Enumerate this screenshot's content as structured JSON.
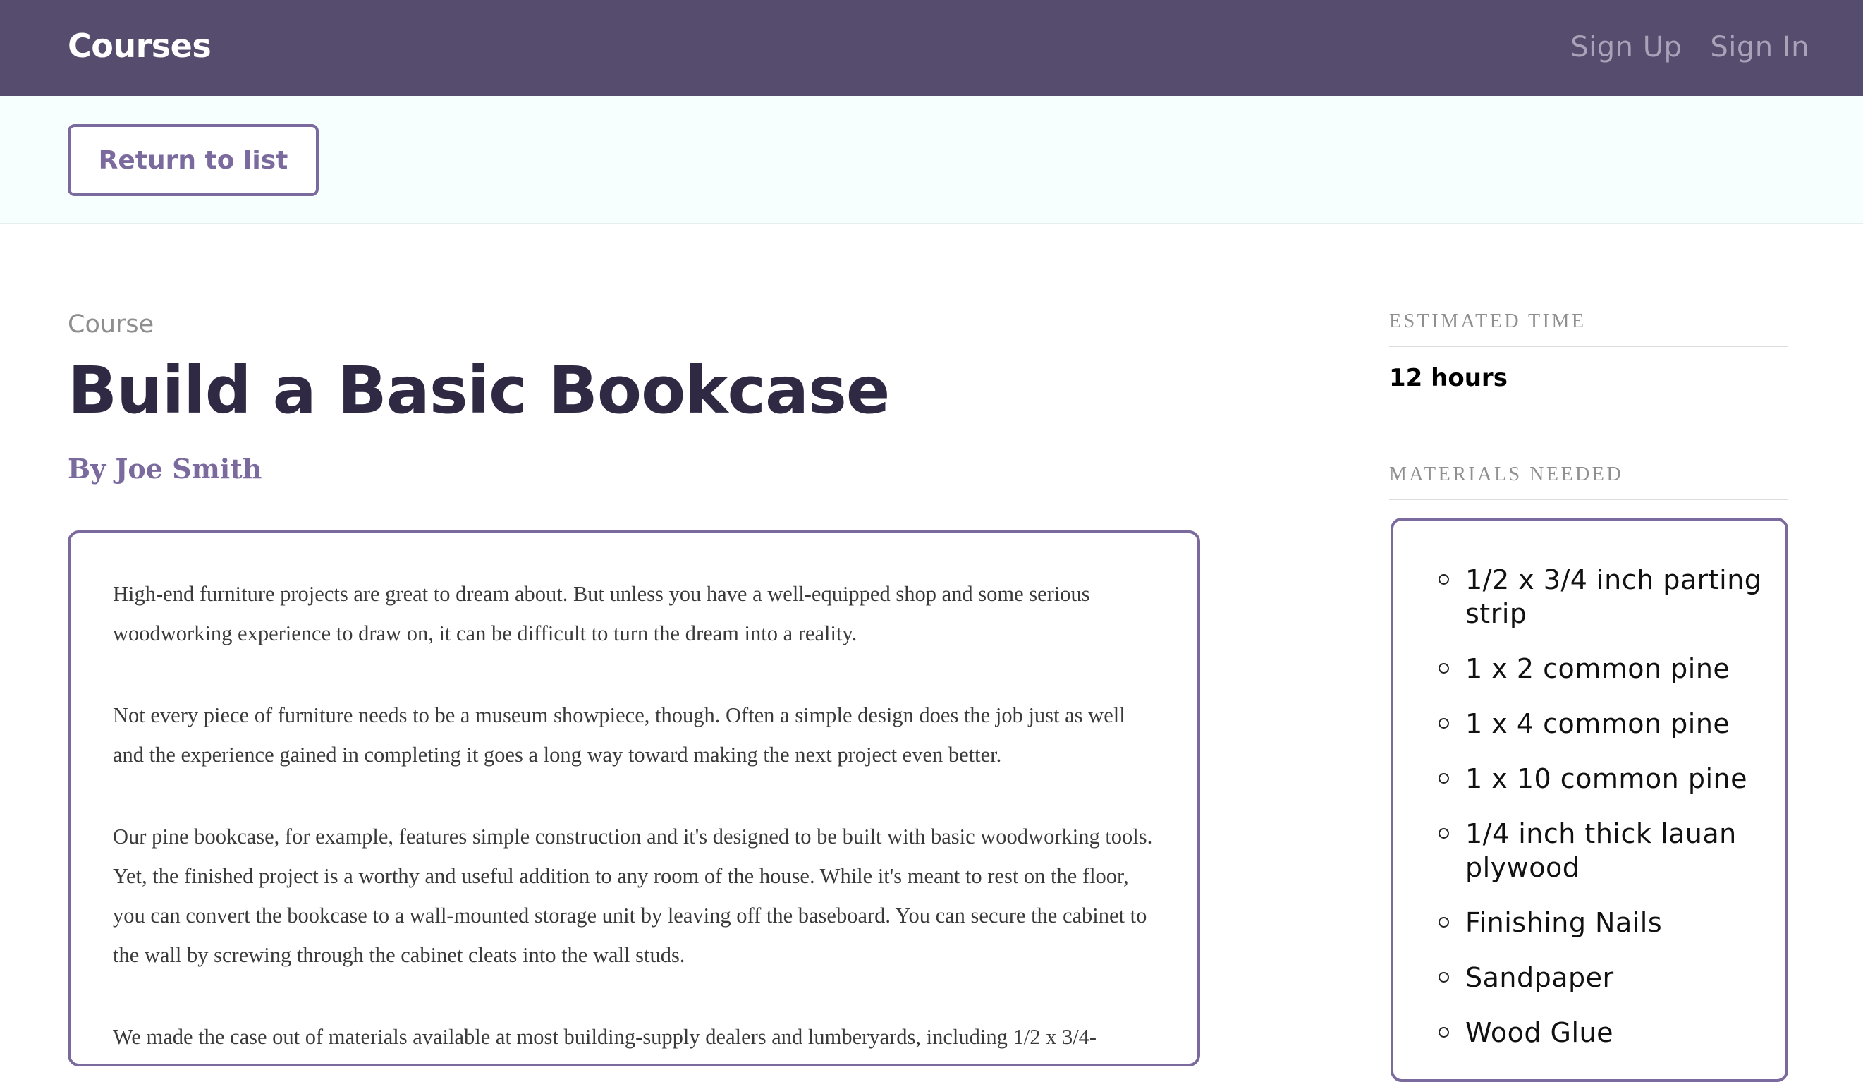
{
  "header": {
    "brand": "Courses",
    "nav": {
      "sign_up": "Sign Up",
      "sign_in": "Sign In"
    }
  },
  "actions": {
    "return_label": "Return to list"
  },
  "course": {
    "label": "Course",
    "title": "Build a Basic Bookcase",
    "byline": "By Joe Smith",
    "description": [
      "High-end furniture projects are great to dream about. But unless you have a well-equipped shop and some serious woodworking experience to draw on, it can be difficult to turn the dream into a reality.",
      "Not every piece of furniture needs to be a museum showpiece, though. Often a simple design does the job just as well and the experience gained in completing it goes a long way toward making the next project even better.",
      "Our pine bookcase, for example, features simple construction and it's designed to be built with basic woodworking tools. Yet, the finished project is a worthy and useful addition to any room of the house. While it's meant to rest on the floor, you can convert the bookcase to a wall-mounted storage unit by leaving off the baseboard. You can secure the cabinet to the wall by screwing through the cabinet cleats into the wall studs.",
      "We made the case out of materials available at most building-supply dealers and lumberyards, including 1/2 x 3/4-"
    ]
  },
  "sidebar": {
    "estimated_time_heading": "Estimated Time",
    "estimated_time_value": "12 hours",
    "materials_heading": "Materials Needed",
    "materials": [
      "1/2 x 3/4 inch parting strip",
      "1 x 2 common pine",
      "1 x 4 common pine",
      "1 x 10 common pine",
      "1/4 inch thick lauan plywood",
      "Finishing Nails",
      "Sandpaper",
      "Wood Glue"
    ]
  },
  "colors": {
    "header_bg": "#564c6d",
    "accent": "#7b6a9d",
    "title_text": "#2f2944",
    "actions_bar_bg": "#f7fefe"
  }
}
